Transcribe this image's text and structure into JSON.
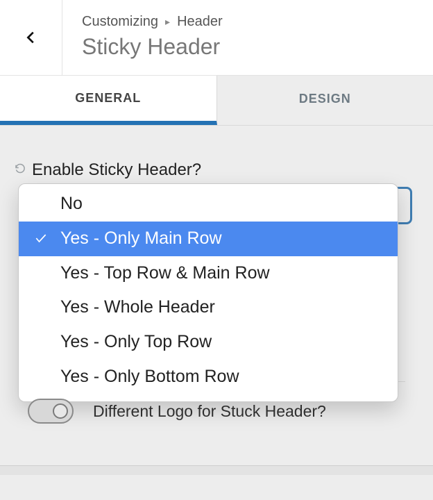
{
  "header": {
    "breadcrumb_root": "Customizing",
    "breadcrumb_section": "Header",
    "title": "Sticky Header"
  },
  "tabs": {
    "general": "GENERAL",
    "design": "DESIGN"
  },
  "enable_field": {
    "label": "Enable Sticky Header?",
    "options": [
      "No",
      "Yes - Only Main Row",
      "Yes - Top Row & Main Row",
      "Yes - Whole Header",
      "Yes - Only Top Row",
      "Yes - Only Bottom Row"
    ],
    "selected_index": 1
  },
  "toggle_field": {
    "label": "Different Logo for Stuck Header?",
    "value": false
  }
}
